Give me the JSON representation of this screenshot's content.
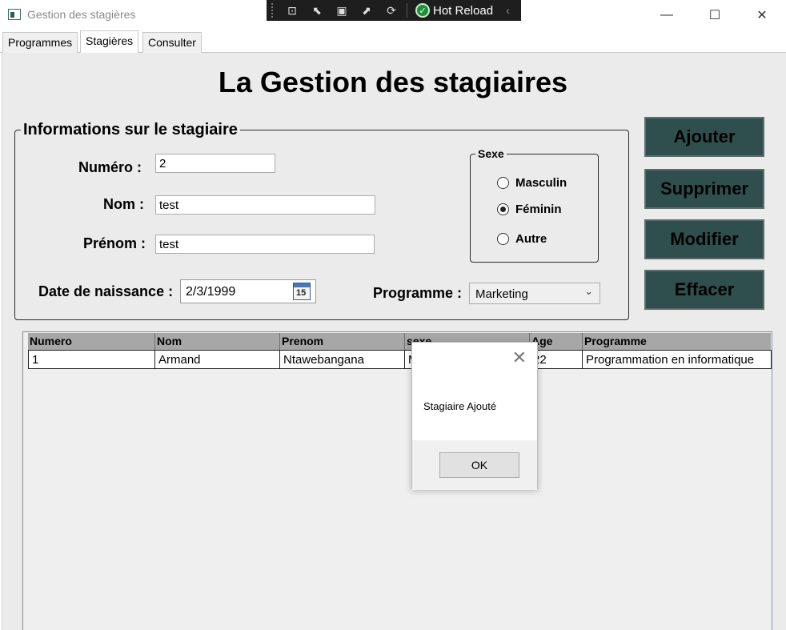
{
  "window": {
    "title": "Gestion des stagières",
    "minimize_glyph": "—",
    "maximize_glyph": "☐",
    "close_glyph": "✕"
  },
  "hot_reload": {
    "label": "Hot Reload"
  },
  "tabs": [
    {
      "label": "Programmes"
    },
    {
      "label": "Stagières",
      "active": true
    },
    {
      "label": "Consulter"
    }
  ],
  "page": {
    "title": "La Gestion des stagiaires"
  },
  "form": {
    "group_title": "Informations sur le stagiaire",
    "numero": {
      "label": "Numéro :",
      "value": "2"
    },
    "nom": {
      "label": "Nom :",
      "value": "test"
    },
    "prenom": {
      "label": "Prénom :",
      "value": "test"
    },
    "date_naissance": {
      "label": "Date de naissance :",
      "value": "2/3/1999",
      "calendar_day": "15"
    },
    "sexe": {
      "title": "Sexe",
      "options": [
        {
          "label": "Masculin",
          "selected": false
        },
        {
          "label": "Féminin",
          "selected": true
        },
        {
          "label": "Autre",
          "selected": false
        }
      ]
    },
    "programme": {
      "label": "Programme :",
      "value": "Marketing"
    }
  },
  "actions": {
    "ajouter": "Ajouter",
    "supprimer": "Supprimer",
    "modifier": "Modifier",
    "effacer": "Effacer"
  },
  "grid": {
    "columns": [
      "Numero",
      "Nom",
      "Prenom",
      "sexe",
      "Age",
      "Programme"
    ],
    "rows": [
      [
        "1",
        "Armand",
        "Ntawebangana",
        "M",
        "22",
        "Programmation en informatique"
      ]
    ]
  },
  "message_box": {
    "text": "Stagiaire Ajouté",
    "ok_label": "OK"
  },
  "colors": {
    "button_bg": "#2f4f4f",
    "background": "#ebebeb"
  }
}
